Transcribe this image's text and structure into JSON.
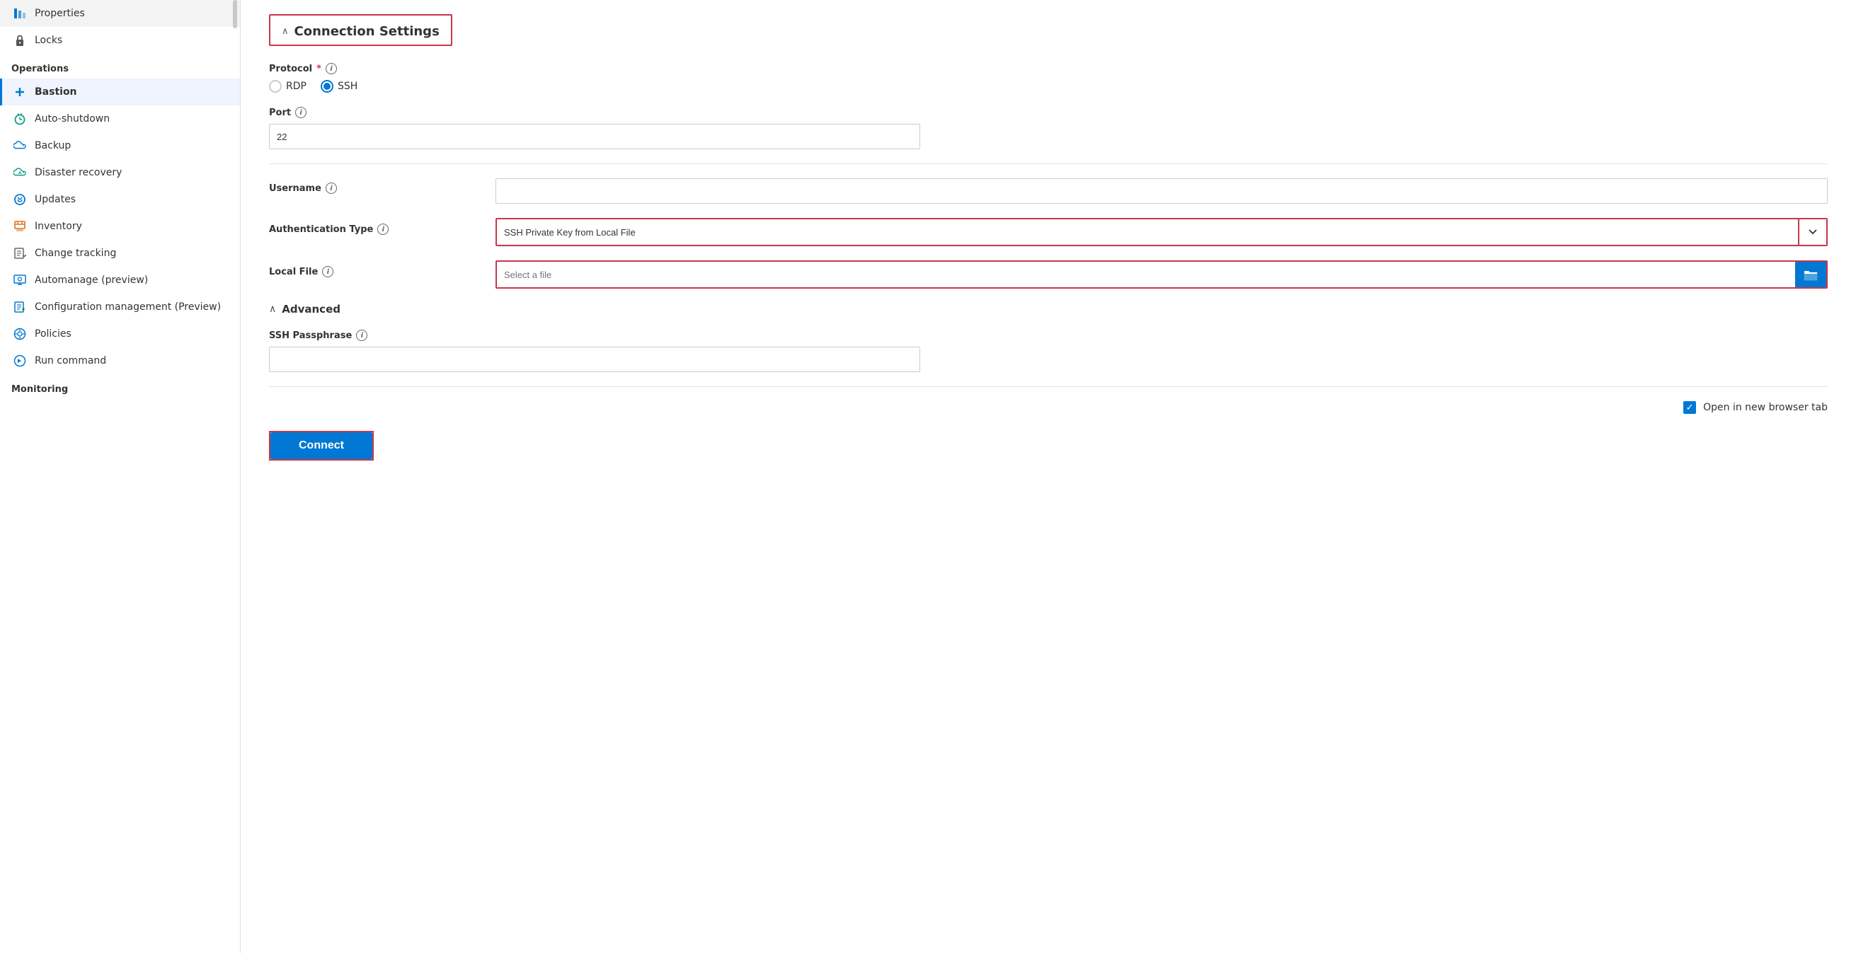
{
  "sidebar": {
    "sections": [
      {
        "label": "",
        "items": [
          {
            "id": "properties",
            "label": "Properties",
            "icon": "bar-chart-icon",
            "iconSymbol": "⚌",
            "iconColor": "icon-blue"
          },
          {
            "id": "locks",
            "label": "Locks",
            "icon": "lock-icon",
            "iconSymbol": "🔒",
            "iconColor": "icon-gray"
          }
        ]
      },
      {
        "label": "Operations",
        "items": [
          {
            "id": "bastion",
            "label": "Bastion",
            "icon": "bastion-icon",
            "iconSymbol": "✕",
            "iconColor": "icon-blue",
            "active": true
          },
          {
            "id": "auto-shutdown",
            "label": "Auto-shutdown",
            "icon": "clock-icon",
            "iconSymbol": "⏰",
            "iconColor": "icon-teal"
          },
          {
            "id": "backup",
            "label": "Backup",
            "icon": "backup-icon",
            "iconSymbol": "☁",
            "iconColor": "icon-blue"
          },
          {
            "id": "disaster-recovery",
            "label": "Disaster recovery",
            "icon": "disaster-icon",
            "iconSymbol": "☁",
            "iconColor": "icon-teal"
          },
          {
            "id": "updates",
            "label": "Updates",
            "icon": "updates-icon",
            "iconSymbol": "⚙",
            "iconColor": "icon-blue"
          },
          {
            "id": "inventory",
            "label": "Inventory",
            "icon": "inventory-icon",
            "iconSymbol": "📦",
            "iconColor": "icon-orange"
          },
          {
            "id": "change-tracking",
            "label": "Change tracking",
            "icon": "change-icon",
            "iconSymbol": "📄",
            "iconColor": "icon-gray"
          },
          {
            "id": "automanage",
            "label": "Automanage (preview)",
            "icon": "automanage-icon",
            "iconSymbol": "🖥",
            "iconColor": "icon-blue"
          },
          {
            "id": "config-mgmt",
            "label": "Configuration management (Preview)",
            "icon": "config-icon",
            "iconSymbol": "📋",
            "iconColor": "icon-blue"
          },
          {
            "id": "policies",
            "label": "Policies",
            "icon": "policies-icon",
            "iconSymbol": "⚙",
            "iconColor": "icon-blue"
          },
          {
            "id": "run-command",
            "label": "Run command",
            "icon": "run-icon",
            "iconSymbol": "⚙",
            "iconColor": "icon-blue"
          }
        ]
      },
      {
        "label": "Monitoring",
        "items": []
      }
    ]
  },
  "main": {
    "connection_settings": {
      "title": "Connection Settings",
      "chevron": "^",
      "protocol_label": "Protocol",
      "protocol_required": "*",
      "rdp_option": "RDP",
      "ssh_option": "SSH",
      "ssh_selected": true,
      "port_label": "Port",
      "port_value": "22",
      "divider1": true,
      "username_label": "Username",
      "auth_type_label": "Authentication Type",
      "auth_type_value": "SSH Private Key from Local File",
      "local_file_label": "Local File",
      "local_file_placeholder": "Select a file",
      "advanced_title": "Advanced",
      "advanced_chevron": "^",
      "ssh_passphrase_label": "SSH Passphrase",
      "ssh_passphrase_value": "",
      "divider2": true,
      "open_new_tab_label": "Open in new browser tab",
      "open_new_tab_checked": true,
      "connect_label": "Connect"
    }
  }
}
